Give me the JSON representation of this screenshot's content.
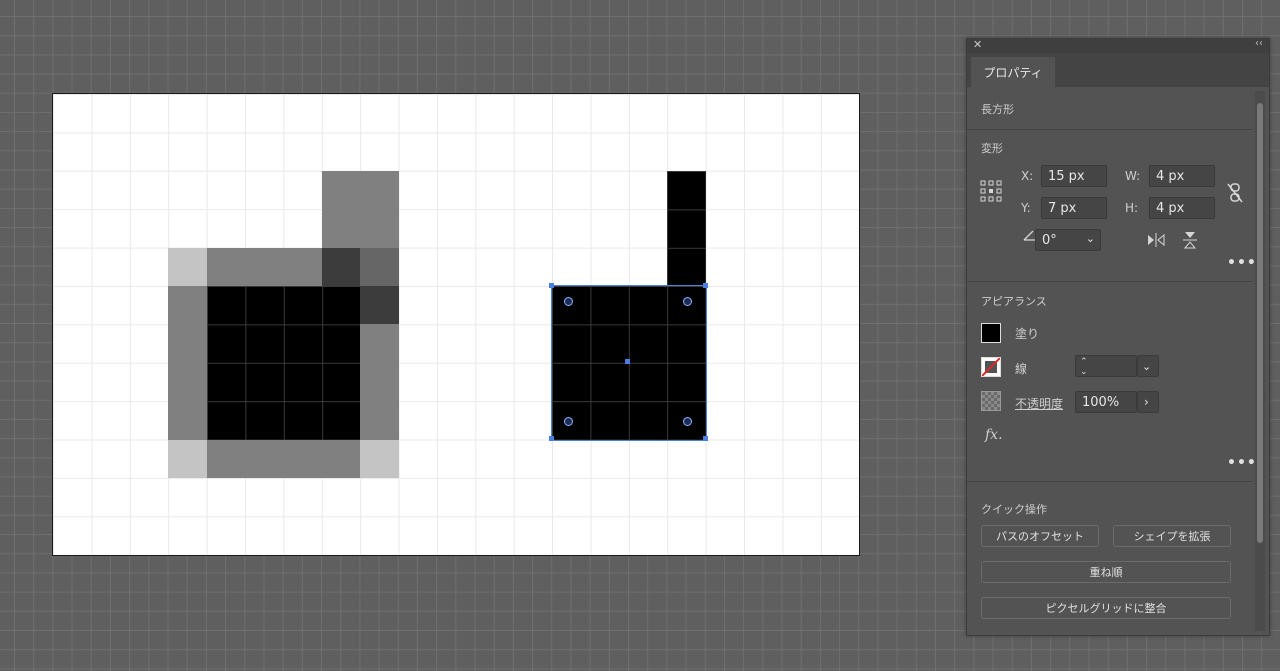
{
  "panel": {
    "tab_label": "プロパティ",
    "object_type": "長方形",
    "transform": {
      "title": "変形",
      "x_label": "X:",
      "x_value": "15 px",
      "y_label": "Y:",
      "y_value": "7 px",
      "w_label": "W:",
      "w_value": "4 px",
      "h_label": "H:",
      "h_value": "4 px",
      "angle_value": "0°"
    },
    "appearance": {
      "title": "アピアランス",
      "fill_label": "塗り",
      "stroke_label": "線",
      "opacity_label": "不透明度",
      "opacity_value": "100%",
      "fx_label": "fx."
    },
    "quick_actions": {
      "title": "クイック操作",
      "offset_path": "パスのオフセット",
      "expand_shape": "シェイプを拡張",
      "arrange": "重ね順",
      "align_pixel_grid": "ピクセルグリッドに整合"
    }
  },
  "colors": {
    "canvas_bg": "#5f5f5f",
    "artboard_bg": "#ffffff",
    "selection": "#4a7fe0",
    "panel_bg": "#535353"
  }
}
